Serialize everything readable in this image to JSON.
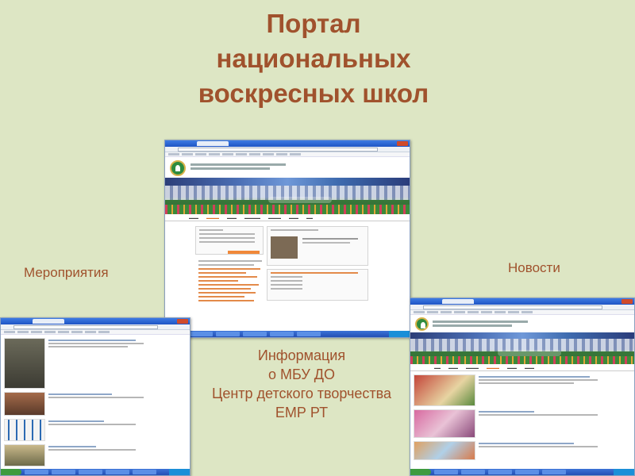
{
  "slide": {
    "title_lines": [
      "Портал",
      "национальных",
      "воскресных школ"
    ],
    "label_events": "Мероприятия",
    "label_news": "Новости",
    "info_lines": [
      "Информация",
      "о МБУ ДО",
      "Центр детского творчества",
      "ЕМР РТ"
    ]
  },
  "colors": {
    "background": "#dde6c4",
    "title_text": "#a0522d",
    "xp_blue": "#2a5bc8",
    "accent_orange": "#e16f24"
  },
  "icons": {
    "site_logo": "green-crest-icon",
    "window_close": "close-icon"
  }
}
